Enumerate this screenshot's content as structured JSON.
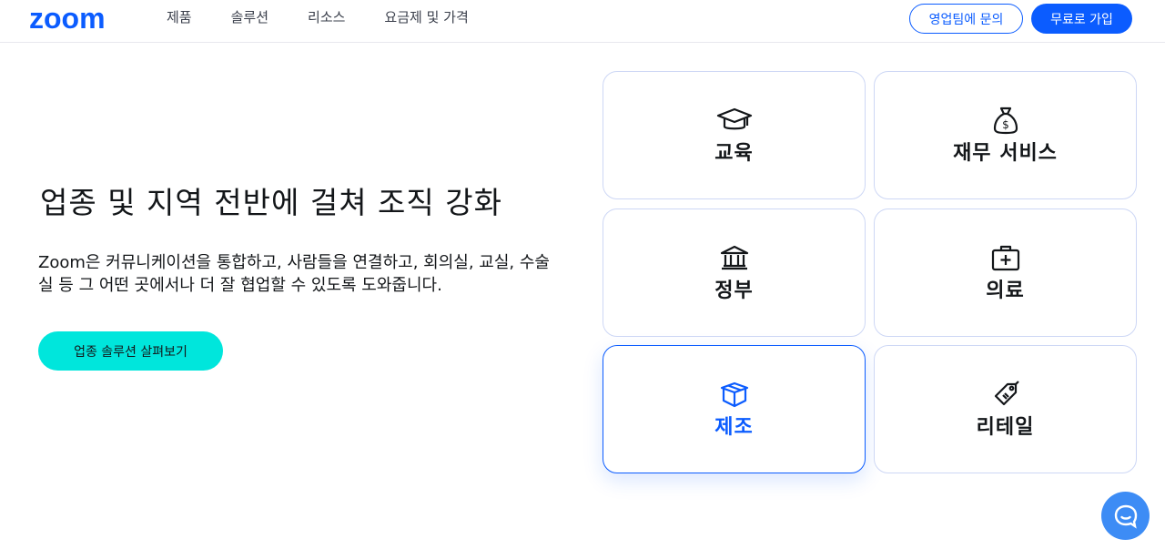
{
  "header": {
    "logo_text": "zoom",
    "nav": [
      "제품",
      "솔루션",
      "리소스",
      "요금제 및 가격"
    ],
    "sales_button": "영업팀에 문의",
    "signup_button": "무료로 가입"
  },
  "hero": {
    "title": "업종 및 지역 전반에 걸쳐 조직 강화",
    "description": "Zoom은 커뮤니케이션을 통합하고, 사람들을 연결하고, 회의실, 교실, 수술실 등 그 어떤 곳에서나 더 잘 협업할 수 있도록 도와줍니다.",
    "cta_button": "업종 솔루션 살펴보기"
  },
  "industries": [
    {
      "label": "교육",
      "icon": "graduation-cap-icon",
      "active": false
    },
    {
      "label": "재무 서비스",
      "icon": "money-bag-icon",
      "active": false
    },
    {
      "label": "정부",
      "icon": "government-building-icon",
      "active": false
    },
    {
      "label": "의료",
      "icon": "medical-kit-icon",
      "active": false
    },
    {
      "label": "제조",
      "icon": "box-icon",
      "active": true
    },
    {
      "label": "리테일",
      "icon": "price-tag-icon",
      "active": false
    }
  ],
  "colors": {
    "brand_blue": "#0b5cff",
    "cta_cyan": "#00e6dc",
    "chat_blue": "#3d8cf5",
    "card_border": "#cdd7f5"
  },
  "chat": {
    "icon": "chat-bubble-icon"
  }
}
